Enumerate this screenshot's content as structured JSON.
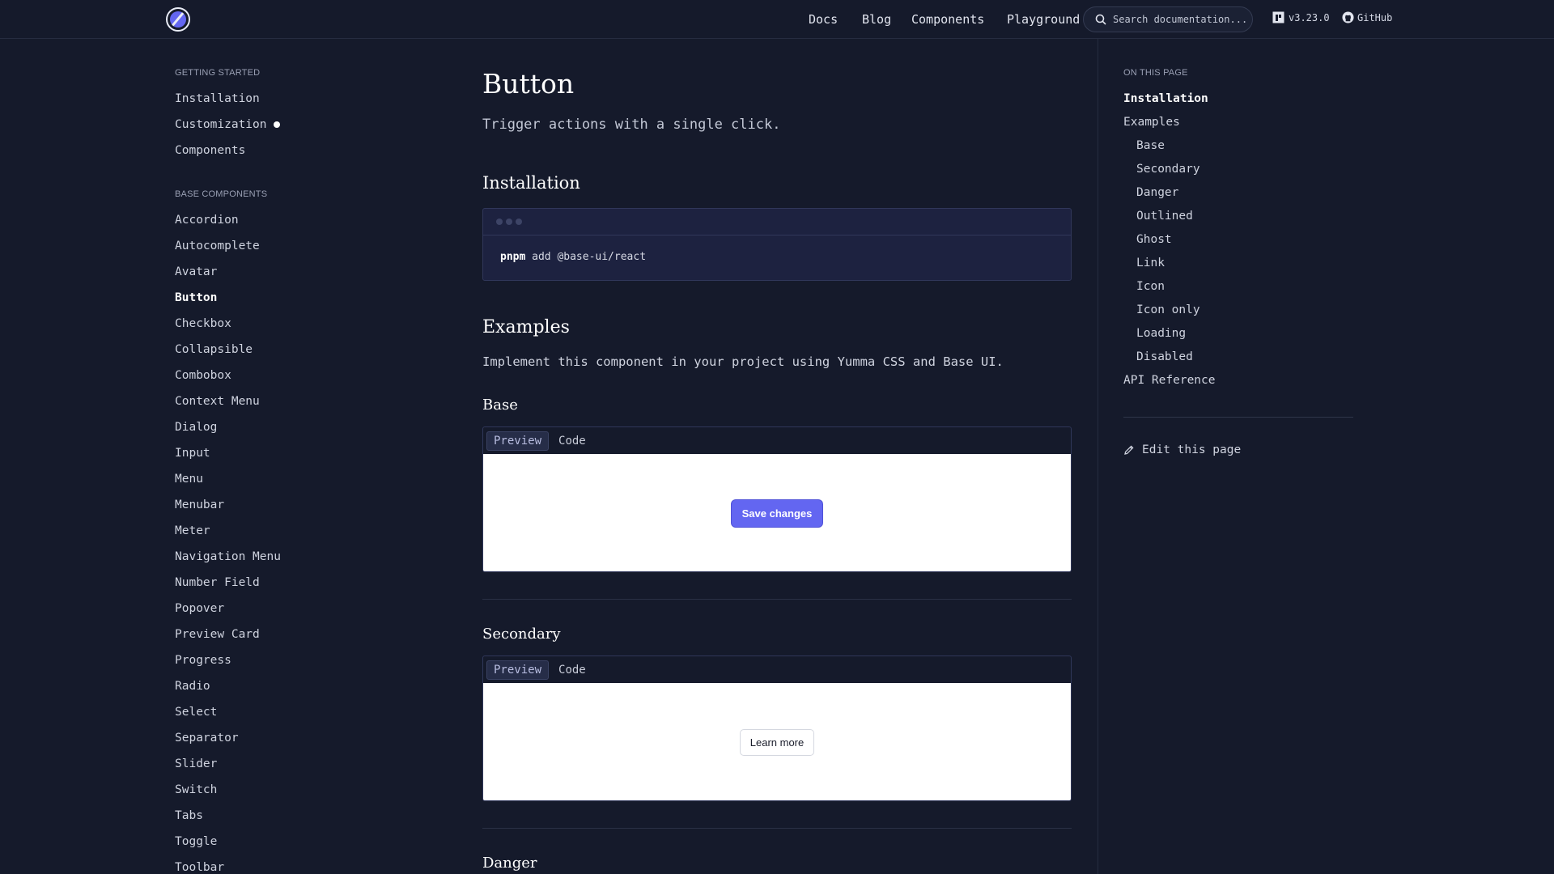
{
  "header": {
    "nav": [
      "Docs",
      "Blog",
      "Components",
      "Playground"
    ],
    "search_placeholder": "Search documentation...",
    "version": "v3.23.0",
    "github": "GitHub"
  },
  "sidebar": {
    "sections": [
      {
        "title": "GETTING STARTED",
        "items": [
          "Installation",
          "Customization",
          "Components"
        ]
      },
      {
        "title": "BASE COMPONENTS",
        "items": [
          "Accordion",
          "Autocomplete",
          "Avatar",
          "Button",
          "Checkbox",
          "Collapsible",
          "Combobox",
          "Context Menu",
          "Dialog",
          "Input",
          "Menu",
          "Menubar",
          "Meter",
          "Navigation Menu",
          "Number Field",
          "Popover",
          "Preview Card",
          "Progress",
          "Radio",
          "Select",
          "Separator",
          "Slider",
          "Switch",
          "Tabs",
          "Toggle",
          "Toolbar"
        ]
      }
    ],
    "active_item": "Button",
    "dot_item": "Customization"
  },
  "main": {
    "title": "Button",
    "subtitle": "Trigger actions with a single click.",
    "installation_heading": "Installation",
    "install_cmd": {
      "tool": "pnpm",
      "rest": " add @base-ui/react"
    },
    "examples_heading": "Examples",
    "examples_desc": "Implement this component in your project using Yumma CSS and Base UI.",
    "tab_preview": "Preview",
    "tab_code": "Code",
    "examples": [
      {
        "title": "Base",
        "button": "Save changes"
      },
      {
        "title": "Secondary",
        "button": "Learn more"
      },
      {
        "title": "Danger"
      }
    ]
  },
  "toc": {
    "title": "ON THIS PAGE",
    "items": [
      "Installation",
      "Examples",
      "Base",
      "Secondary",
      "Danger",
      "Outlined",
      "Ghost",
      "Link",
      "Icon",
      "Icon only",
      "Loading",
      "Disabled",
      "API Reference"
    ],
    "active": "Installation",
    "edit": "Edit this page"
  }
}
